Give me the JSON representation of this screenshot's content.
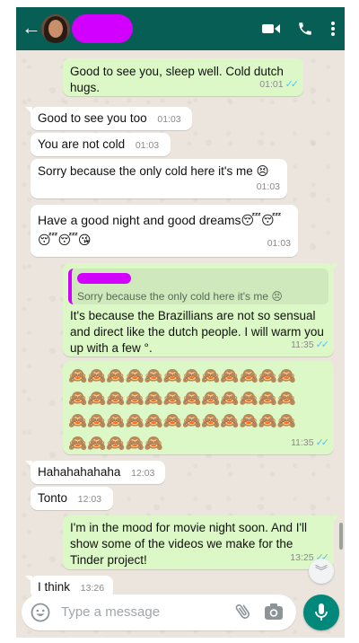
{
  "header": {
    "contact_name_redacted": true
  },
  "messages": [
    {
      "dir": "out",
      "text": "Good to see you, sleep well. Cold dutch hugs.",
      "time": "01:01",
      "read": true
    },
    {
      "dir": "in",
      "text": "Good to see you too",
      "time": "01:03"
    },
    {
      "dir": "in",
      "text": "You are not cold",
      "time": "01:03"
    },
    {
      "dir": "in",
      "text": "Sorry because the only cold here it's me 😣",
      "time": "01:03"
    },
    {
      "dir": "in",
      "text": "Have a good night and good dreams😴😴 😴😴😘",
      "time": "01:03"
    },
    {
      "dir": "out",
      "quote": {
        "author_redacted": true,
        "text": "Sorry because the only cold here it's me 😣"
      },
      "text": "It's because the Brazillians are not so sensual and direct like the dutch people. I will warm you up with a few °.",
      "time": "11:35",
      "read": true
    },
    {
      "dir": "out",
      "emoji_rows": [
        "🙈🙈🙈🙈🙈🙈🙈🙈🙈🙈🙈🙈",
        "🙈🙈🙈🙈🙈🙈🙈🙈🙈🙈🙈🙈",
        "🙈🙈🙈🙈🙈🙈🙈🙈🙈🙈🙈🙈",
        "🙈🙈🙈🙈🙈"
      ],
      "time": "11:35",
      "read": true
    },
    {
      "dir": "in",
      "text": "Hahahahahaha",
      "time": "12:03"
    },
    {
      "dir": "in",
      "text": "Tonto",
      "time": "12:03"
    },
    {
      "dir": "out",
      "text": "I'm in the mood for movie night soon. And I'll show some of the videos we make for the Tinder project!",
      "time": "13:25",
      "read": true
    },
    {
      "dir": "in",
      "text": "I think",
      "time": "13:26"
    }
  ],
  "composer": {
    "placeholder": "Type a message"
  },
  "icons": {
    "back": "arrow-left-icon",
    "video": "video-call-icon",
    "call": "phone-icon",
    "menu": "more-vertical-icon",
    "emoji": "smiley-icon",
    "attach": "paperclip-icon",
    "camera": "camera-icon",
    "mic": "microphone-icon",
    "scroll": "chevron-double-down-icon"
  },
  "colors": {
    "header": "#075e54",
    "chat_bg": "#ece5dd",
    "outgoing_bubble": "#dcf8c6",
    "incoming_bubble": "#ffffff",
    "read_ticks": "#4fc3f7",
    "mic_button": "#00897b",
    "redaction": "#d200ff"
  }
}
